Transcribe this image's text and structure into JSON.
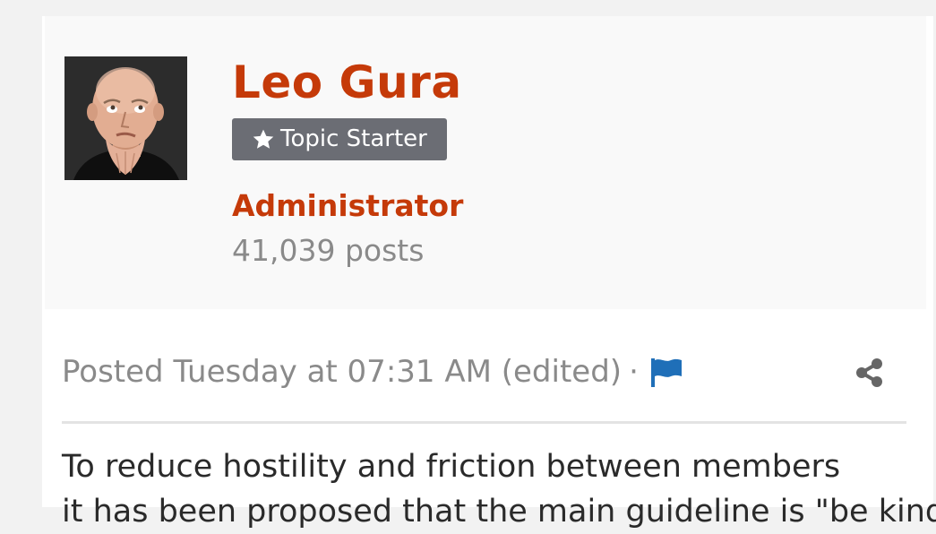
{
  "author": {
    "name": "Leo Gura",
    "badge_label": "Topic Starter",
    "role": "Administrator",
    "post_count": "41,039 posts",
    "avatar_icon": "user-avatar-photo"
  },
  "post": {
    "meta_prefix": "Posted Tuesday at 07:31 AM (edited)",
    "meta_separator": "·",
    "report_icon": "flag-icon",
    "share_icon": "share-icon",
    "body_line_1": "To reduce hostility and friction between members",
    "body_line_2": "it has been proposed that the main guideline is \"be kind\""
  },
  "colors": {
    "brand": "#c53a09",
    "badge_bg": "#6b6d74",
    "link_blue": "#1f6fb8",
    "muted": "#8a8a8a"
  }
}
